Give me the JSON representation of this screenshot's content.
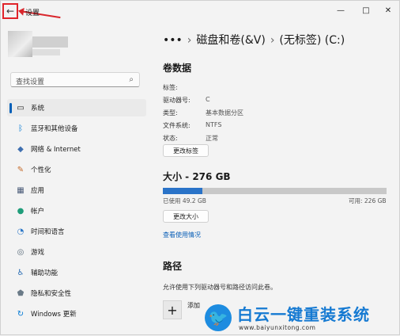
{
  "window": {
    "title": "设置",
    "controls": {
      "minimize": "—",
      "maximize": "□",
      "close": "✕"
    }
  },
  "sidebar": {
    "search_placeholder": "查找设置",
    "items": [
      {
        "label": "系统",
        "icon": "monitor-icon",
        "selected": true
      },
      {
        "label": "蓝牙和其他设备",
        "icon": "bluetooth-icon"
      },
      {
        "label": "网络 & Internet",
        "icon": "wifi-icon"
      },
      {
        "label": "个性化",
        "icon": "brush-icon"
      },
      {
        "label": "应用",
        "icon": "apps-icon"
      },
      {
        "label": "帐户",
        "icon": "person-icon"
      },
      {
        "label": "时间和语言",
        "icon": "globe-clock-icon"
      },
      {
        "label": "游戏",
        "icon": "gamepad-icon"
      },
      {
        "label": "辅助功能",
        "icon": "accessibility-icon"
      },
      {
        "label": "隐私和安全性",
        "icon": "shield-icon"
      },
      {
        "label": "Windows 更新",
        "icon": "update-icon"
      }
    ]
  },
  "breadcrumb": {
    "ellipsis": "•••",
    "parent": "磁盘和卷(&V)",
    "current": "(无标签) (C:)"
  },
  "volume_data": {
    "title": "卷数据",
    "properties": [
      {
        "label": "标签:",
        "value": ""
      },
      {
        "label": "驱动器号:",
        "value": "C"
      },
      {
        "label": "类型:",
        "value": "基本数据分区"
      },
      {
        "label": "文件系统:",
        "value": "NTFS"
      },
      {
        "label": "状态:",
        "value": "正常"
      }
    ],
    "change_label_button": "更改标签"
  },
  "size": {
    "title": "大小 - 276 GB",
    "used_text": "已使用 49.2 GB",
    "available_text": "可用: 226 GB",
    "used_fraction": 0.178,
    "change_size_button": "更改大小",
    "view_usage_link": "查看使用情况"
  },
  "path": {
    "title": "路径",
    "description": "允许使用下列驱动器号和路径访问此卷。",
    "add_label": "添加"
  },
  "watermark": {
    "title": "白云一键重装系统",
    "url": "www.baiyunxitong.com"
  },
  "colors": {
    "accent": "#005fb8",
    "usage_fill": "#2a73c8",
    "highlight": "#e0242a"
  }
}
